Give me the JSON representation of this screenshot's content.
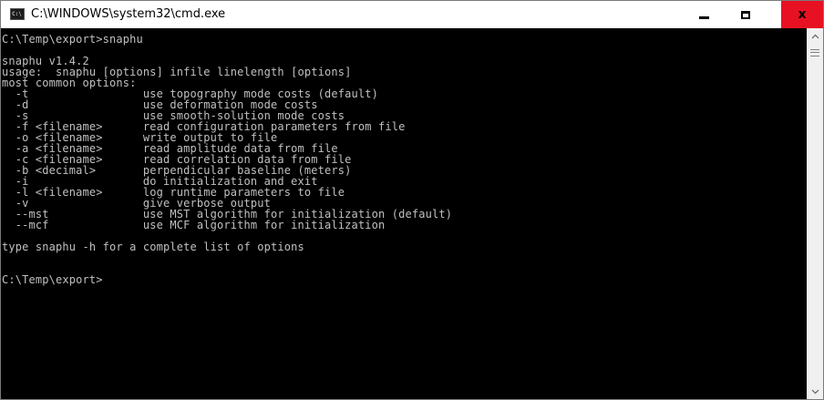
{
  "window": {
    "title": "C:\\WINDOWS\\system32\\cmd.exe",
    "icon_label": "C:\\",
    "icon": "cmd-icon",
    "minimize_symbol": "",
    "maximize_symbol": "",
    "close_symbol": "x",
    "close_color": "#e81123"
  },
  "console": {
    "background": "#000000",
    "foreground": "#c0c0c0",
    "lines": [
      "C:\\Temp\\export>snaphu",
      "",
      "snaphu v1.4.2",
      "usage:  snaphu [options] infile linelength [options]",
      "most common options:",
      "  -t                 use topography mode costs (default)",
      "  -d                 use deformation mode costs",
      "  -s                 use smooth-solution mode costs",
      "  -f <filename>      read configuration parameters from file",
      "  -o <filename>      write output to file",
      "  -a <filename>      read amplitude data from file",
      "  -c <filename>      read correlation data from file",
      "  -b <decimal>       perpendicular baseline (meters)",
      "  -i                 do initialization and exit",
      "  -l <filename>      log runtime parameters to file",
      "  -v                 give verbose output",
      "  --mst              use MST algorithm for initialization (default)",
      "  --mcf              use MCF algorithm for initialization",
      "",
      "type snaphu -h for a complete list of options",
      "",
      "",
      "C:\\Temp\\export>"
    ]
  },
  "scrollbar": {
    "up_arrow": "^",
    "down_arrow": "v"
  }
}
